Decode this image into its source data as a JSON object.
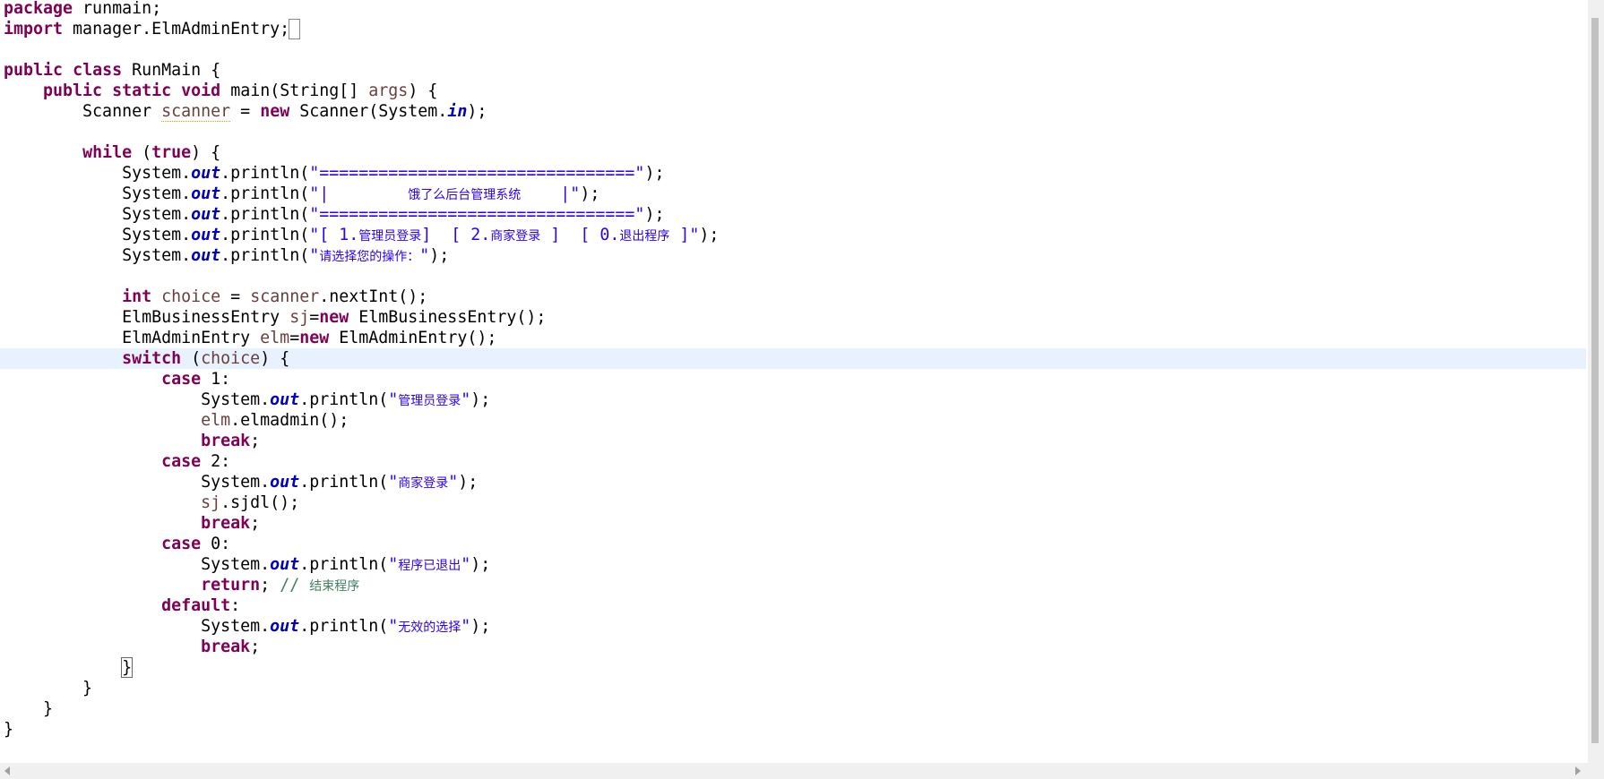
{
  "editor": {
    "lines": [
      {
        "segments": [
          {
            "t": "package",
            "c": "k"
          },
          {
            "t": " runmain;"
          }
        ]
      },
      {
        "segments": [
          {
            "t": "import",
            "c": "k"
          },
          {
            "t": " manager.ElmAdminEntry;"
          },
          {
            "t": " ",
            "c": "box"
          }
        ]
      },
      {
        "segments": []
      },
      {
        "segments": [
          {
            "t": "public",
            "c": "k"
          },
          {
            "t": " "
          },
          {
            "t": "class",
            "c": "k"
          },
          {
            "t": " RunMain {"
          }
        ]
      },
      {
        "segments": [
          {
            "t": "    "
          },
          {
            "t": "public",
            "c": "k"
          },
          {
            "t": " "
          },
          {
            "t": "static",
            "c": "k"
          },
          {
            "t": " "
          },
          {
            "t": "void",
            "c": "k"
          },
          {
            "t": " main(String[] "
          },
          {
            "t": "args",
            "c": "v"
          },
          {
            "t": ") {"
          }
        ]
      },
      {
        "segments": [
          {
            "t": "        Scanner "
          },
          {
            "t": "scanner",
            "c": "v warn"
          },
          {
            "t": " = "
          },
          {
            "t": "new",
            "c": "k"
          },
          {
            "t": " Scanner(System."
          },
          {
            "t": "in",
            "c": "f"
          },
          {
            "t": ");"
          }
        ]
      },
      {
        "segments": []
      },
      {
        "segments": [
          {
            "t": "        "
          },
          {
            "t": "while",
            "c": "k"
          },
          {
            "t": " ("
          },
          {
            "t": "true",
            "c": "k"
          },
          {
            "t": ") {"
          }
        ]
      },
      {
        "segments": [
          {
            "t": "            System."
          },
          {
            "t": "out",
            "c": "f"
          },
          {
            "t": ".println("
          },
          {
            "t": "\"================================\"",
            "c": "s"
          },
          {
            "t": ");"
          }
        ]
      },
      {
        "segments": [
          {
            "t": "            System."
          },
          {
            "t": "out",
            "c": "f"
          },
          {
            "t": ".println("
          },
          {
            "t": "\"|        ",
            "c": "s"
          },
          {
            "t": "饿了么后台管理系统",
            "c": "s cjk"
          },
          {
            "t": "    |\"",
            "c": "s"
          },
          {
            "t": ");"
          }
        ]
      },
      {
        "segments": [
          {
            "t": "            System."
          },
          {
            "t": "out",
            "c": "f"
          },
          {
            "t": ".println("
          },
          {
            "t": "\"================================\"",
            "c": "s"
          },
          {
            "t": ");"
          }
        ]
      },
      {
        "segments": [
          {
            "t": "            System."
          },
          {
            "t": "out",
            "c": "f"
          },
          {
            "t": ".println("
          },
          {
            "t": "\"[ 1.",
            "c": "s"
          },
          {
            "t": "管理员登录",
            "c": "s cjk"
          },
          {
            "t": "]  [ 2.",
            "c": "s"
          },
          {
            "t": "商家登录",
            "c": "s cjk"
          },
          {
            "t": " ]  [ 0.",
            "c": "s"
          },
          {
            "t": "退出程序",
            "c": "s cjk"
          },
          {
            "t": " ]\"",
            "c": "s"
          },
          {
            "t": ");"
          }
        ]
      },
      {
        "segments": [
          {
            "t": "            System."
          },
          {
            "t": "out",
            "c": "f"
          },
          {
            "t": ".println("
          },
          {
            "t": "\"",
            "c": "s"
          },
          {
            "t": "请选择您的操作：",
            "c": "s cjk"
          },
          {
            "t": "\"",
            "c": "s"
          },
          {
            "t": ");"
          }
        ]
      },
      {
        "segments": []
      },
      {
        "segments": [
          {
            "t": "            "
          },
          {
            "t": "int",
            "c": "k"
          },
          {
            "t": " "
          },
          {
            "t": "choice",
            "c": "v"
          },
          {
            "t": " = "
          },
          {
            "t": "scanner",
            "c": "v"
          },
          {
            "t": ".nextInt();"
          }
        ]
      },
      {
        "segments": [
          {
            "t": "            ElmBusinessEntry "
          },
          {
            "t": "sj",
            "c": "v"
          },
          {
            "t": "="
          },
          {
            "t": "new",
            "c": "k"
          },
          {
            "t": " ElmBusinessEntry();"
          }
        ]
      },
      {
        "segments": [
          {
            "t": "            ElmAdminEntry "
          },
          {
            "t": "elm",
            "c": "v"
          },
          {
            "t": "="
          },
          {
            "t": "new",
            "c": "k"
          },
          {
            "t": " ElmAdminEntry();"
          }
        ]
      },
      {
        "current": true,
        "segments": [
          {
            "t": "            "
          },
          {
            "t": "switch",
            "c": "k"
          },
          {
            "t": " ("
          },
          {
            "t": "choice",
            "c": "v"
          },
          {
            "t": ") {"
          }
        ]
      },
      {
        "segments": [
          {
            "t": "                "
          },
          {
            "t": "case",
            "c": "k"
          },
          {
            "t": " 1:"
          }
        ]
      },
      {
        "segments": [
          {
            "t": "                    System."
          },
          {
            "t": "out",
            "c": "f"
          },
          {
            "t": ".println("
          },
          {
            "t": "\"",
            "c": "s"
          },
          {
            "t": "管理员登录",
            "c": "s cjk"
          },
          {
            "t": "\"",
            "c": "s"
          },
          {
            "t": ");"
          }
        ]
      },
      {
        "segments": [
          {
            "t": "                    "
          },
          {
            "t": "elm",
            "c": "v"
          },
          {
            "t": ".elmadmin();"
          }
        ]
      },
      {
        "segments": [
          {
            "t": "                    "
          },
          {
            "t": "break",
            "c": "k"
          },
          {
            "t": ";"
          }
        ]
      },
      {
        "segments": [
          {
            "t": "                "
          },
          {
            "t": "case",
            "c": "k"
          },
          {
            "t": " 2:"
          }
        ]
      },
      {
        "segments": [
          {
            "t": "                    System."
          },
          {
            "t": "out",
            "c": "f"
          },
          {
            "t": ".println("
          },
          {
            "t": "\"",
            "c": "s"
          },
          {
            "t": "商家登录",
            "c": "s cjk"
          },
          {
            "t": "\"",
            "c": "s"
          },
          {
            "t": ");"
          }
        ]
      },
      {
        "segments": [
          {
            "t": "                    "
          },
          {
            "t": "sj",
            "c": "v"
          },
          {
            "t": ".sjdl();"
          }
        ]
      },
      {
        "segments": [
          {
            "t": "                    "
          },
          {
            "t": "break",
            "c": "k"
          },
          {
            "t": ";"
          }
        ]
      },
      {
        "segments": [
          {
            "t": "                "
          },
          {
            "t": "case",
            "c": "k"
          },
          {
            "t": " 0:"
          }
        ]
      },
      {
        "segments": [
          {
            "t": "                    System."
          },
          {
            "t": "out",
            "c": "f"
          },
          {
            "t": ".println("
          },
          {
            "t": "\"",
            "c": "s"
          },
          {
            "t": "程序已退出",
            "c": "s cjk"
          },
          {
            "t": "\"",
            "c": "s"
          },
          {
            "t": ");"
          }
        ]
      },
      {
        "segments": [
          {
            "t": "                    "
          },
          {
            "t": "return",
            "c": "k"
          },
          {
            "t": "; "
          },
          {
            "t": "// ",
            "c": "c"
          },
          {
            "t": "结束程序",
            "c": "c cjk"
          }
        ]
      },
      {
        "segments": [
          {
            "t": "                "
          },
          {
            "t": "default",
            "c": "k"
          },
          {
            "t": ":"
          }
        ]
      },
      {
        "segments": [
          {
            "t": "                    System."
          },
          {
            "t": "out",
            "c": "f"
          },
          {
            "t": ".println("
          },
          {
            "t": "\"",
            "c": "s"
          },
          {
            "t": "无效的选择",
            "c": "s cjk"
          },
          {
            "t": "\"",
            "c": "s"
          },
          {
            "t": ");"
          }
        ]
      },
      {
        "segments": [
          {
            "t": "                    "
          },
          {
            "t": "break",
            "c": "k"
          },
          {
            "t": ";"
          }
        ]
      },
      {
        "segments": [
          {
            "t": "            "
          },
          {
            "t": "}",
            "c": "matchbox"
          }
        ]
      },
      {
        "segments": [
          {
            "t": "        }"
          }
        ]
      },
      {
        "segments": [
          {
            "t": "    }"
          }
        ]
      },
      {
        "segments": [
          {
            "t": "}"
          }
        ]
      }
    ]
  },
  "colors": {
    "keyword": "#7f0055",
    "static_field": "#0000c0",
    "string": "#2a00ff",
    "comment": "#3f7f5f",
    "variable": "#6a3e3e",
    "current_line": "#e8f2fe"
  }
}
